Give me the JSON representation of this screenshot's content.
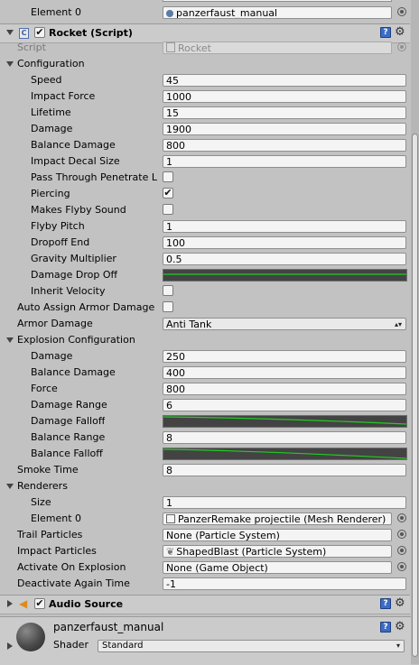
{
  "top": {
    "element0_label": "Element 0",
    "element0_value": "panzerfaust_manual"
  },
  "rocket": {
    "title": "Rocket (Script)",
    "script_label": "Script",
    "script_value": "Rocket",
    "configuration": {
      "label": "Configuration",
      "speed_label": "Speed",
      "speed": "45",
      "impact_force_label": "Impact Force",
      "impact_force": "1000",
      "lifetime_label": "Lifetime",
      "lifetime": "15",
      "damage_label": "Damage",
      "damage": "1900",
      "balance_damage_label": "Balance Damage",
      "balance_damage": "800",
      "impact_decal_size_label": "Impact Decal Size",
      "impact_decal_size": "1",
      "pass_through_label": "Pass Through Penetrate L",
      "pass_through": false,
      "piercing_label": "Piercing",
      "piercing": true,
      "makes_flyby_sound_label": "Makes Flyby Sound",
      "makes_flyby_sound": false,
      "flyby_pitch_label": "Flyby Pitch",
      "flyby_pitch": "1",
      "dropoff_end_label": "Dropoff End",
      "dropoff_end": "100",
      "gravity_multiplier_label": "Gravity Multiplier",
      "gravity_multiplier": "0.5",
      "damage_drop_off_label": "Damage Drop Off",
      "inherit_velocity_label": "Inherit Velocity",
      "inherit_velocity": false
    },
    "auto_assign_label": "Auto Assign Armor Damage",
    "auto_assign": false,
    "armor_damage_label": "Armor Damage",
    "armor_damage": "Anti Tank",
    "explosion": {
      "label": "Explosion Configuration",
      "damage_label": "Damage",
      "damage": "250",
      "balance_damage_label": "Balance Damage",
      "balance_damage": "400",
      "force_label": "Force",
      "force": "800",
      "damage_range_label": "Damage Range",
      "damage_range": "6",
      "damage_falloff_label": "Damage Falloff",
      "balance_range_label": "Balance Range",
      "balance_range": "8",
      "balance_falloff_label": "Balance Falloff"
    },
    "smoke_time_label": "Smoke Time",
    "smoke_time": "8",
    "renderers": {
      "label": "Renderers",
      "size_label": "Size",
      "size": "1",
      "element0_label": "Element 0",
      "element0": "PanzerRemake projectile (Mesh Renderer)"
    },
    "trail_particles_label": "Trail Particles",
    "trail_particles": "None (Particle System)",
    "impact_particles_label": "Impact Particles",
    "impact_particles": "ShapedBlast (Particle System)",
    "activate_on_explosion_label": "Activate On Explosion",
    "activate_on_explosion": "None (Game Object)",
    "deactivate_again_time_label": "Deactivate Again Time",
    "deactivate_again_time": "-1"
  },
  "audio_source": {
    "title": "Audio Source"
  },
  "material": {
    "name": "panzerfaust_manual",
    "shader_label": "Shader",
    "shader_value": "Standard"
  },
  "colors": {
    "curve_line": "#22cc22",
    "curve_bg": "#434343",
    "panel_bg": "#c2c2c2"
  }
}
